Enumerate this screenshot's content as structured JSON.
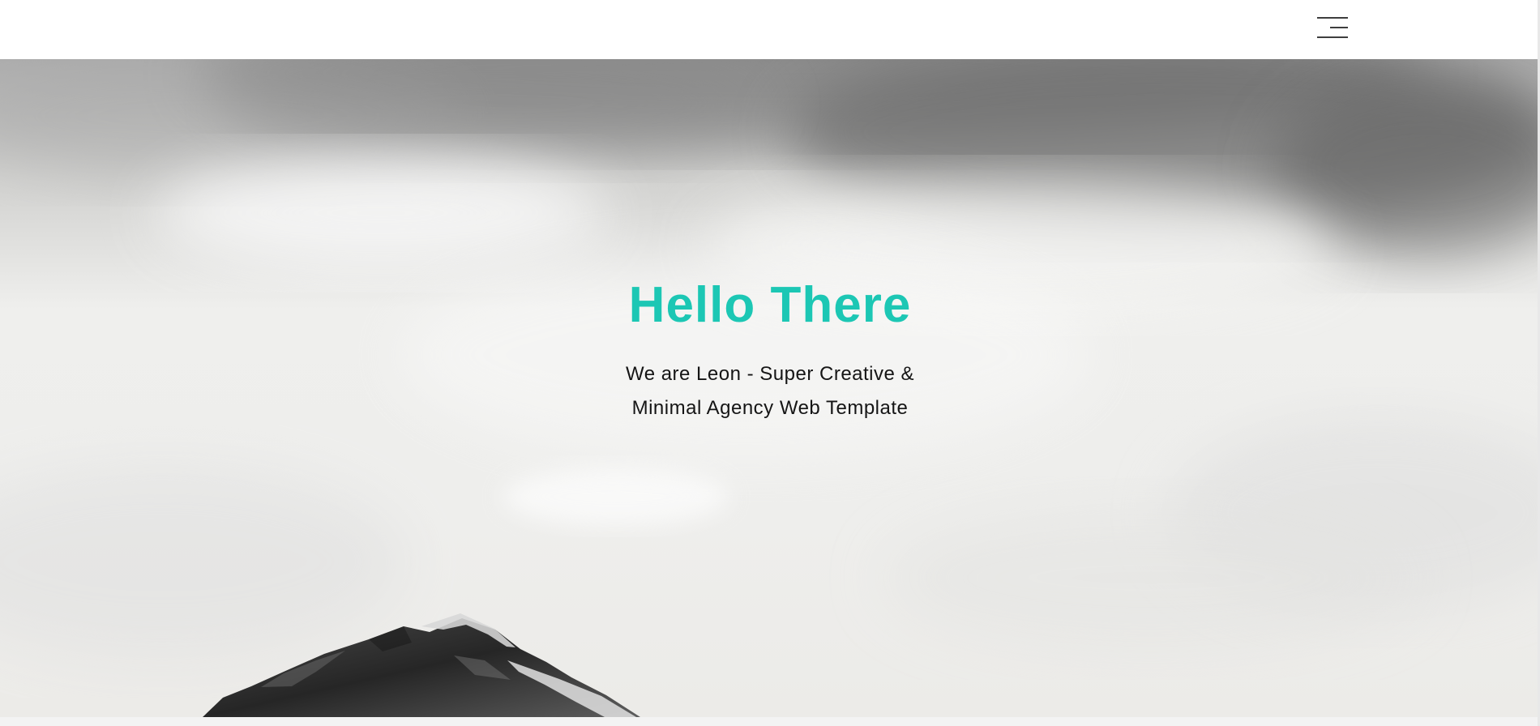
{
  "navbar": {
    "menu_icon": "hamburger-menu-icon"
  },
  "hero": {
    "title": "Hello There",
    "subtitle_line_1": "We are Leon - Super Creative &",
    "subtitle_line_2": "Minimal Agency Web Template",
    "background_image": "cloudy-mountain-sky-image"
  },
  "colors": {
    "accent": "#1cc7b4",
    "text": "#151515",
    "nav_background": "#ffffff"
  }
}
